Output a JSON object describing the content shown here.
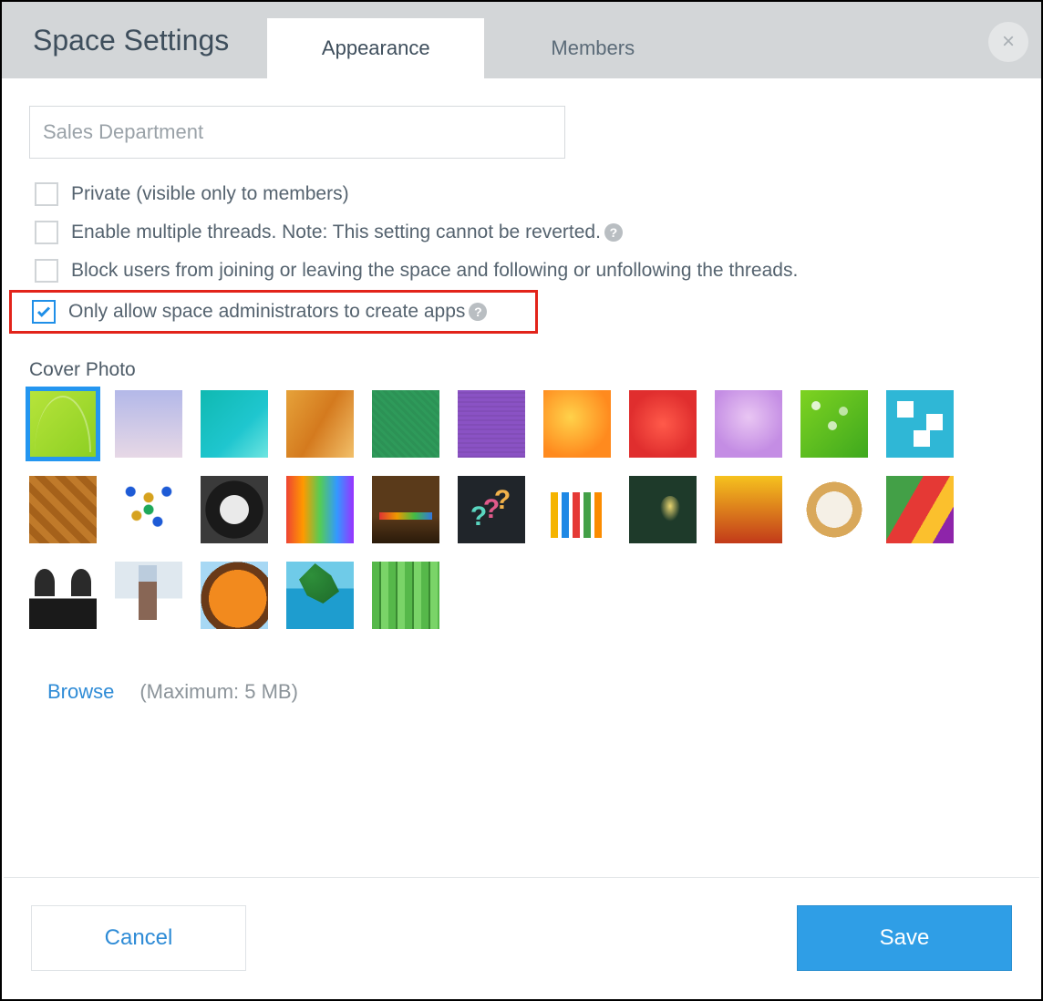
{
  "header": {
    "title": "Space Settings",
    "tabs": [
      {
        "label": "Appearance",
        "active": true
      },
      {
        "label": "Members",
        "active": false
      }
    ],
    "close_glyph": "×"
  },
  "form": {
    "name_value": "Sales Department",
    "options": [
      {
        "label": "Private (visible only to members)",
        "checked": false,
        "help": false
      },
      {
        "label": "Enable multiple threads. Note: This setting cannot be reverted.",
        "checked": false,
        "help": true
      },
      {
        "label": "Block users from joining or leaving the space and following or unfollowing the threads.",
        "checked": false,
        "help": false
      },
      {
        "label": "Only allow space administrators to create apps",
        "checked": true,
        "help": true,
        "highlighted": true
      }
    ],
    "help_glyph": "?"
  },
  "cover": {
    "label": "Cover Photo",
    "selected_index": 0,
    "thumb_count": 27,
    "browse_label": "Browse",
    "max_note": "(Maximum: 5 MB)"
  },
  "footer": {
    "cancel_label": "Cancel",
    "save_label": "Save"
  }
}
